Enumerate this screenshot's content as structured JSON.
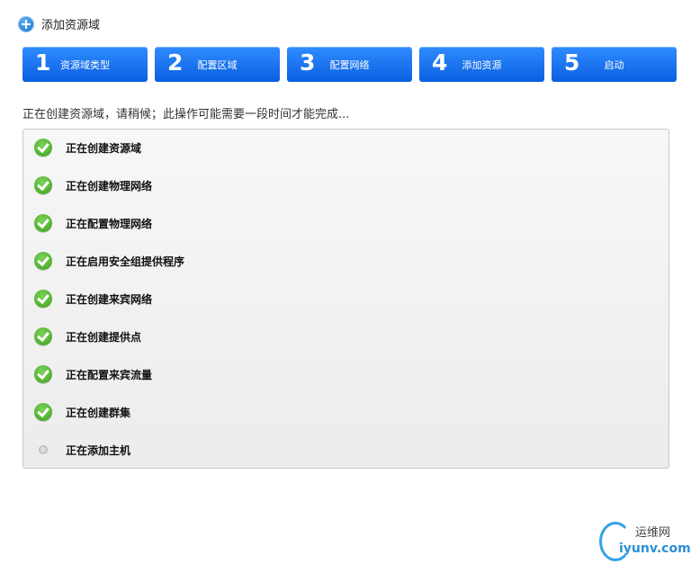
{
  "header": {
    "title": "添加资源域"
  },
  "steps": [
    {
      "num": "1",
      "label": "资源域类型"
    },
    {
      "num": "2",
      "label": "配置区域"
    },
    {
      "num": "3",
      "label": "配置网络"
    },
    {
      "num": "4",
      "label": "添加资源"
    },
    {
      "num": "5",
      "label": "启动"
    }
  ],
  "status": "正在创建资源域，请稍候；此操作可能需要一段时间才能完成...",
  "tasks": [
    {
      "label": "正在创建资源域",
      "state": "done"
    },
    {
      "label": "正在创建物理网络",
      "state": "done"
    },
    {
      "label": "正在配置物理网络",
      "state": "done"
    },
    {
      "label": "正在启用安全组提供程序",
      "state": "done"
    },
    {
      "label": "正在创建来宾网络",
      "state": "done"
    },
    {
      "label": "正在创建提供点",
      "state": "done"
    },
    {
      "label": "正在配置来宾流量",
      "state": "done"
    },
    {
      "label": "正在创建群集",
      "state": "done"
    },
    {
      "label": "正在添加主机",
      "state": "pending"
    }
  ],
  "watermark": {
    "top": "运维网",
    "bottom": "iyunv.com"
  },
  "colors": {
    "step_bg": "#1a74f0",
    "check": "#4caf2a"
  }
}
